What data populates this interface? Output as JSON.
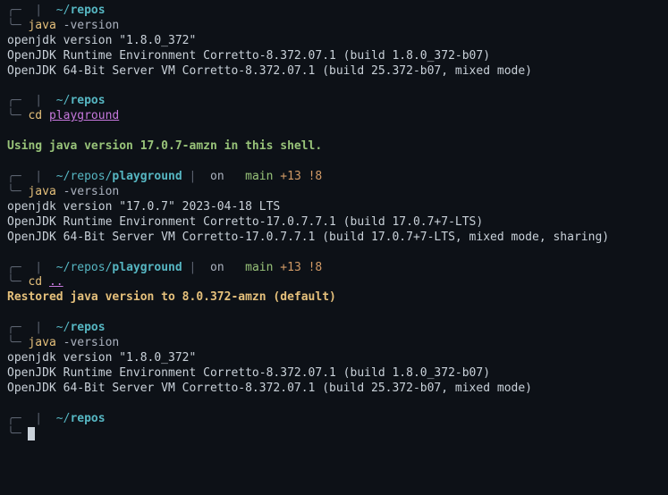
{
  "prompt1": {
    "path": "~/repos",
    "repo": "repos",
    "cmd": "java",
    "args": "-version"
  },
  "output1": {
    "l1": "openjdk version \"1.8.0_372\"",
    "l2": "OpenJDK Runtime Environment Corretto-8.372.07.1 (build 1.8.0_372-b07)",
    "l3": "OpenJDK 64-Bit Server VM Corretto-8.372.07.1 (build 25.372-b07, mixed mode)"
  },
  "prompt2": {
    "path": "~/repos",
    "repo": "repos",
    "cmd": "cd",
    "target": "playground"
  },
  "msg2": "Using java version 17.0.7-amzn in this shell.",
  "prompt3": {
    "pathPrefix": "~/repos/",
    "pathLeaf": "playground",
    "on": " on ",
    "branchIcon": "🐙",
    "branch": " main",
    "status": " +13 !8",
    "cmd": "java",
    "args": "-version"
  },
  "output3": {
    "l1": "openjdk version \"17.0.7\" 2023-04-18 LTS",
    "l2": "OpenJDK Runtime Environment Corretto-17.0.7.7.1 (build 17.0.7+7-LTS)",
    "l3": "OpenJDK 64-Bit Server VM Corretto-17.0.7.7.1 (build 17.0.7+7-LTS, mixed mode, sharing)"
  },
  "prompt4": {
    "pathPrefix": "~/repos/",
    "pathLeaf": "playground",
    "on": " on ",
    "branch": " main",
    "status": " +13 !8",
    "cmd": "cd",
    "target": ".."
  },
  "msg4": "Restored java version to 8.0.372-amzn (default)",
  "prompt5": {
    "path": "~/repos",
    "repo": "repos",
    "cmd": "java",
    "args": "-version"
  },
  "output5": {
    "l1": "openjdk version \"1.8.0_372\"",
    "l2": "OpenJDK Runtime Environment Corretto-8.372.07.1 (build 1.8.0_372-b07)",
    "l3": "OpenJDK 64-Bit Server VM Corretto-8.372.07.1 (build 25.372-b07, mixed mode)"
  },
  "prompt6": {
    "path": "~/repos",
    "repo": "repos"
  },
  "sym": {
    "topCap": "╭─",
    "botCap": "╰─",
    "pipe": " | ",
    "folder": " ",
    "tilde": "~/",
    "git": " "
  }
}
